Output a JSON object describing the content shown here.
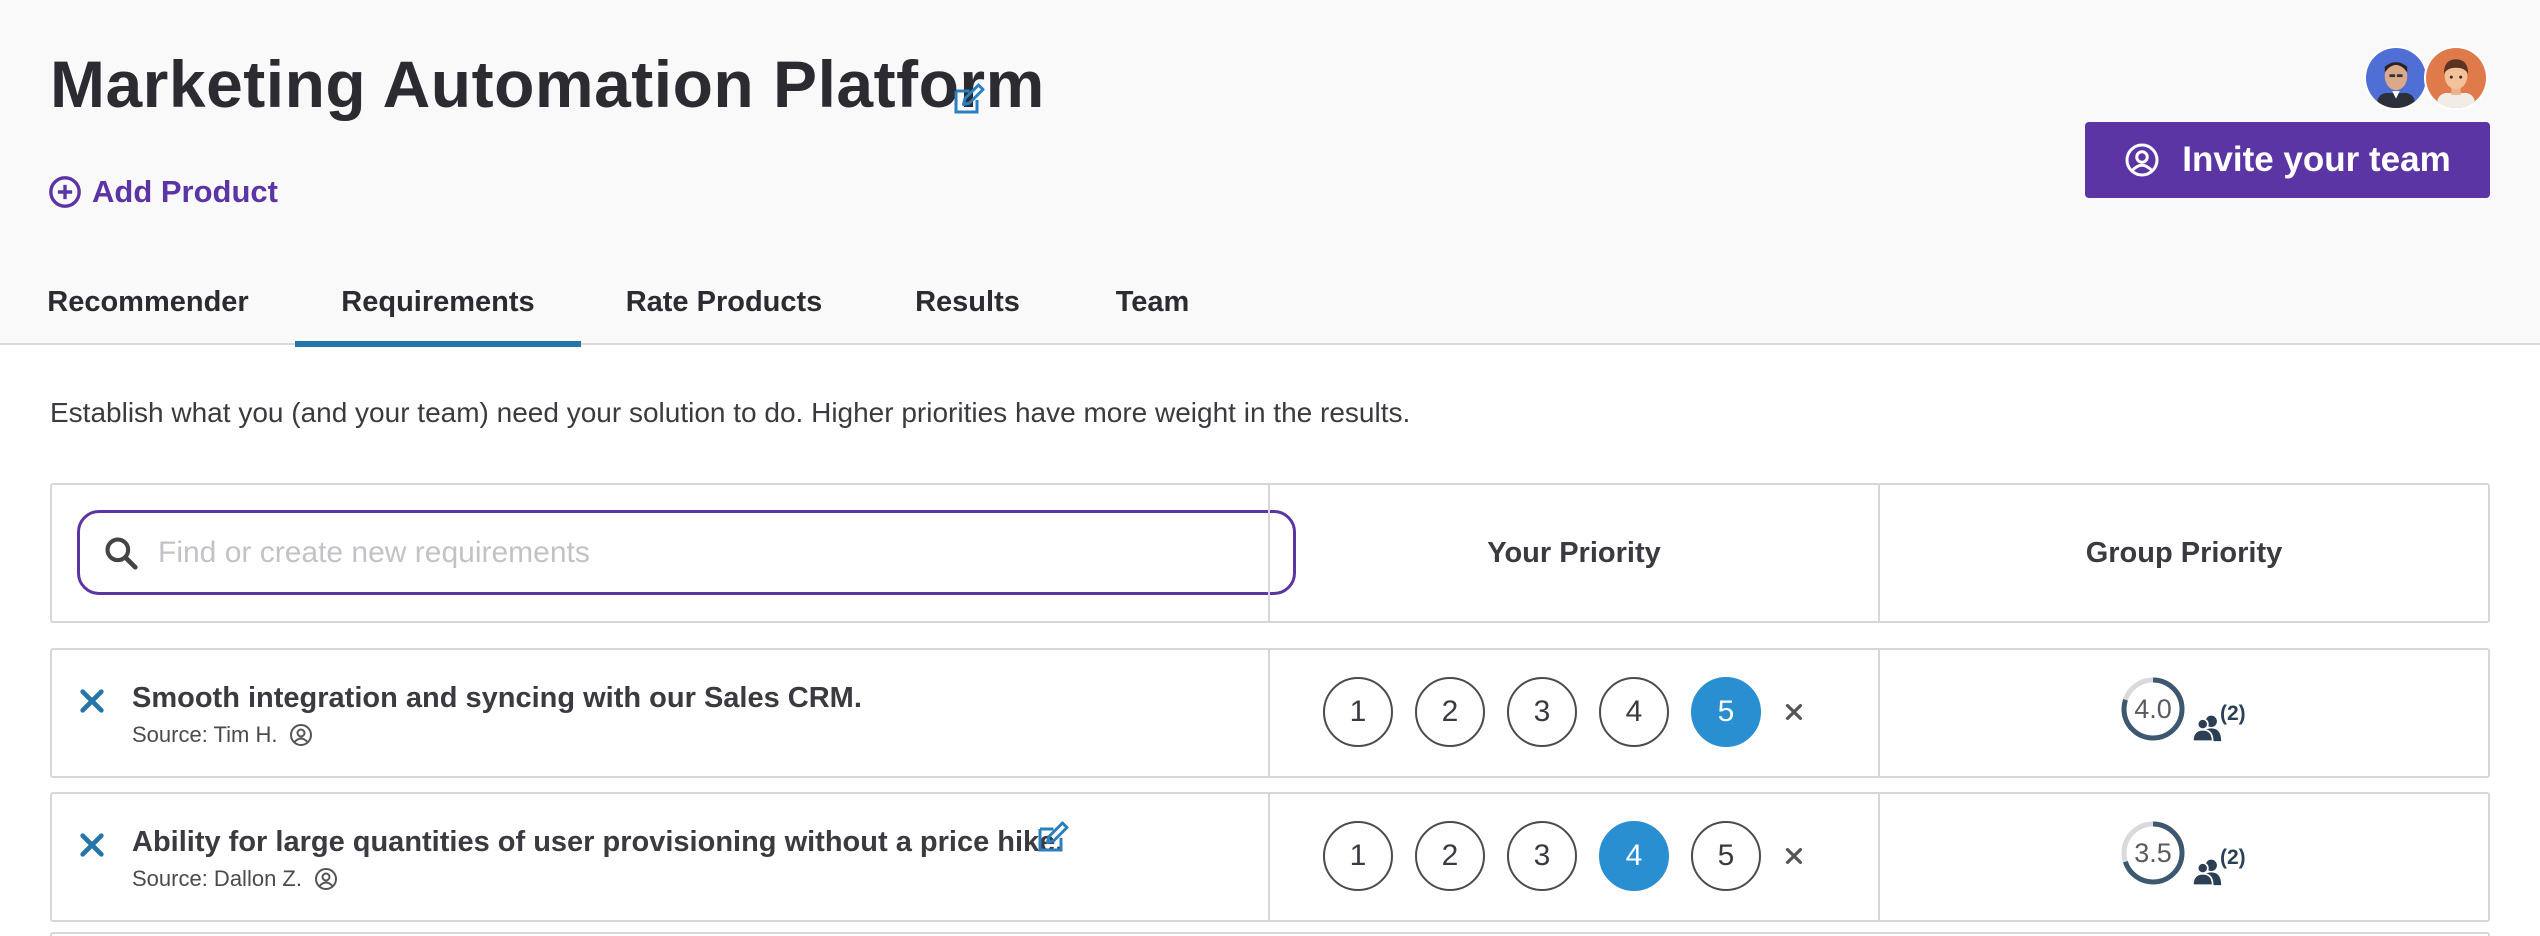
{
  "header": {
    "title": "Marketing Automation Platform",
    "add_product_label": "Add Product",
    "invite_label": "Invite your team",
    "avatars": [
      "user-avatar-1",
      "user-avatar-2"
    ]
  },
  "tabs": [
    {
      "label": "Recommender",
      "active": false
    },
    {
      "label": "Requirements",
      "active": true
    },
    {
      "label": "Rate Products",
      "active": false
    },
    {
      "label": "Results",
      "active": false
    },
    {
      "label": "Team",
      "active": false
    }
  ],
  "intro": "Establish what you (and your team) need your solution to do. Higher priorities have more weight in the results.",
  "table": {
    "search_placeholder": "Find or create new requirements",
    "search_value": "",
    "col_your_priority": "Your Priority",
    "col_group_priority": "Group Priority",
    "priority_options": [
      "1",
      "2",
      "3",
      "4",
      "5"
    ],
    "rows": [
      {
        "text": "Smooth integration and syncing with our Sales CRM.",
        "source": "Source: Tim H.",
        "editable": false,
        "your_priority": 5,
        "group_score": "4.0",
        "group_score_value": 4.0,
        "group_count": "(2)"
      },
      {
        "text": "Ability for large quantities of user provisioning without a price hike.",
        "source": "Source: Dallon Z.",
        "editable": true,
        "your_priority": 4,
        "group_score": "3.5",
        "group_score_value": 3.5,
        "group_count": "(2)"
      }
    ]
  },
  "colors": {
    "brand_purple": "#5b35a3",
    "selected_blue": "#2a8fd1",
    "tab_underline": "#2576a8",
    "remove_blue": "#2576a8"
  }
}
